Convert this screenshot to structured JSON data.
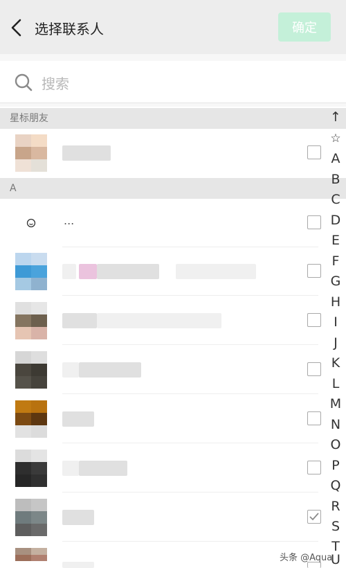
{
  "header": {
    "title": "选择联系人",
    "confirm_label": "确定",
    "accent_disabled": "#c4f0d9"
  },
  "search": {
    "placeholder": "搜索",
    "icon": "search-icon"
  },
  "sections": {
    "starred_label": "星标朋友",
    "a_label": "A"
  },
  "contacts": [
    {
      "section": "starred",
      "checked": false
    },
    {
      "section": "A",
      "name_visible": "...",
      "checked": false
    },
    {
      "section": "A",
      "checked": false
    },
    {
      "section": "A",
      "checked": false
    },
    {
      "section": "A",
      "checked": false
    },
    {
      "section": "A",
      "checked": false
    },
    {
      "section": "A",
      "checked": false
    },
    {
      "section": "A",
      "checked": true
    },
    {
      "section": "A",
      "checked": false
    }
  ],
  "index_bar": {
    "items": [
      "↑",
      "☆",
      "A",
      "B",
      "C",
      "D",
      "E",
      "F",
      "G",
      "H",
      "I",
      "J",
      "K",
      "L",
      "M",
      "N",
      "O",
      "P",
      "Q",
      "R",
      "S",
      "T",
      "U"
    ]
  },
  "watermark": "头条 @Aqua"
}
